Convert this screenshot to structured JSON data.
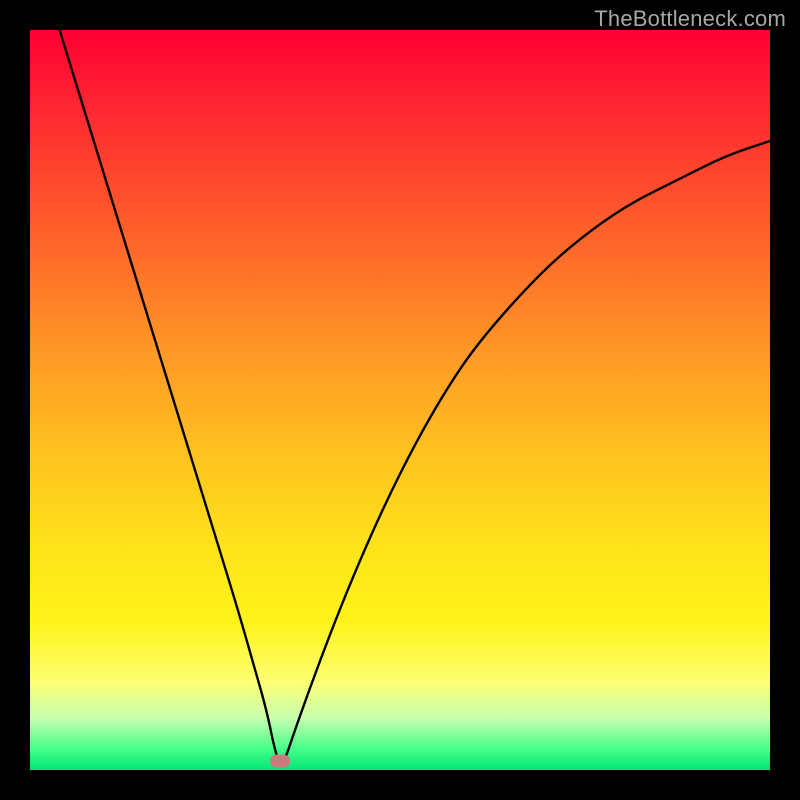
{
  "watermark": "TheBottleneck.com",
  "chart_data": {
    "type": "line",
    "title": "",
    "xlabel": "",
    "ylabel": "",
    "xlim": [
      0,
      100
    ],
    "ylim": [
      0,
      100
    ],
    "grid": false,
    "legend": false,
    "x": [
      0,
      4,
      8,
      12,
      16,
      20,
      24,
      28,
      30,
      32,
      33,
      34,
      36,
      40,
      44,
      48,
      52,
      56,
      60,
      66,
      72,
      80,
      88,
      94,
      100
    ],
    "y": [
      113,
      100,
      87,
      74,
      61,
      48,
      35,
      22,
      15,
      8,
      3,
      0,
      6,
      17,
      27,
      36,
      44,
      51,
      57,
      64,
      70,
      76,
      80,
      83,
      85
    ],
    "marker": {
      "x": 33.8,
      "y": 1.2
    },
    "background_gradient": {
      "direction": "vertical",
      "stops": [
        {
          "pos": 0.0,
          "color": "#ff0033"
        },
        {
          "pos": 0.5,
          "color": "#ffc41f"
        },
        {
          "pos": 0.8,
          "color": "#fff31a"
        },
        {
          "pos": 0.95,
          "color": "#9bff9b"
        },
        {
          "pos": 1.0,
          "color": "#00e676"
        }
      ]
    }
  }
}
